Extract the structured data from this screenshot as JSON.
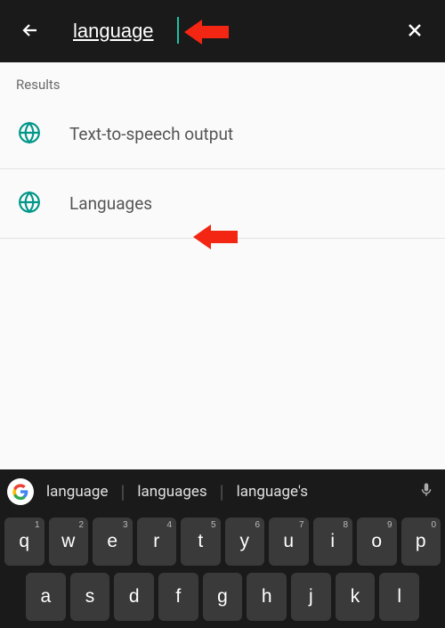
{
  "search": {
    "value": "language"
  },
  "results": {
    "label": "Results",
    "items": [
      {
        "label": "Text-to-speech output"
      },
      {
        "label": "Languages"
      }
    ]
  },
  "keyboard": {
    "suggestions": [
      "language",
      "languages",
      "language's"
    ],
    "row1": [
      {
        "k": "q",
        "s": "1"
      },
      {
        "k": "w",
        "s": "2"
      },
      {
        "k": "e",
        "s": "3"
      },
      {
        "k": "r",
        "s": "4"
      },
      {
        "k": "t",
        "s": "5"
      },
      {
        "k": "y",
        "s": "6"
      },
      {
        "k": "u",
        "s": "7"
      },
      {
        "k": "i",
        "s": "8"
      },
      {
        "k": "o",
        "s": "9"
      },
      {
        "k": "p",
        "s": "0"
      }
    ],
    "row2": [
      {
        "k": "a"
      },
      {
        "k": "s"
      },
      {
        "k": "d"
      },
      {
        "k": "f"
      },
      {
        "k": "g"
      },
      {
        "k": "h"
      },
      {
        "k": "j"
      },
      {
        "k": "k"
      },
      {
        "k": "l"
      }
    ]
  },
  "annotations": {
    "arrow_color": "#f22613"
  }
}
